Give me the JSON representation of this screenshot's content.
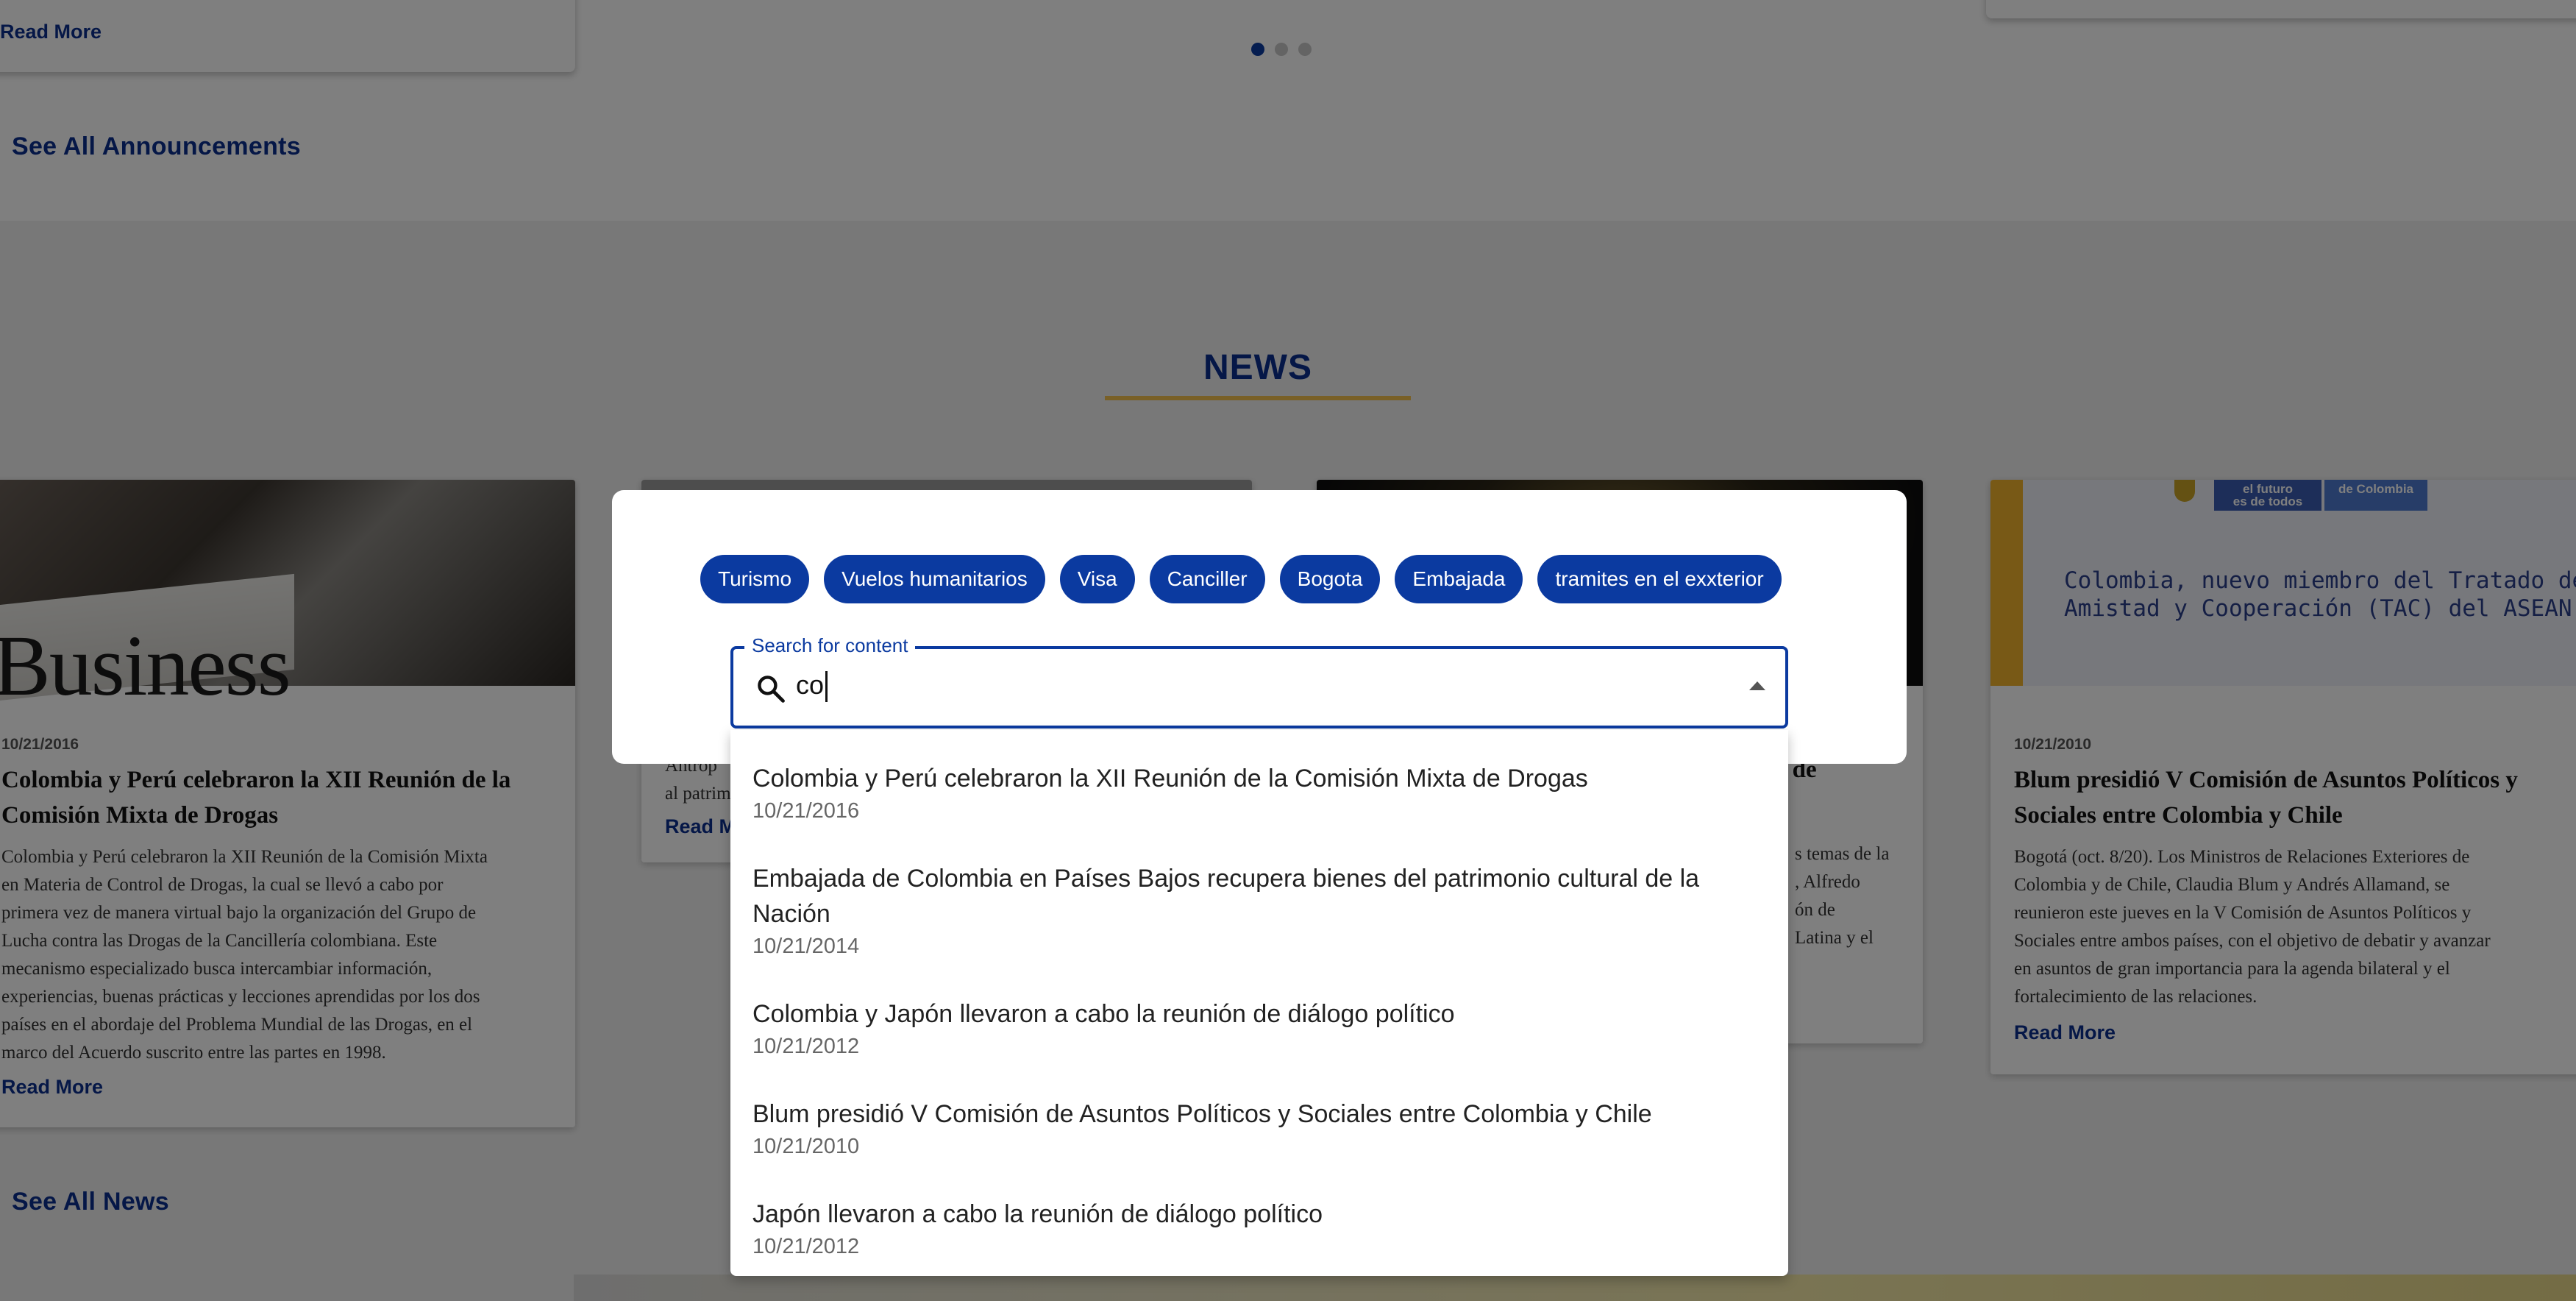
{
  "announcements": {
    "fragment_text": "marco del Acuerdo suscrito entre las partes en 1998.",
    "read_more": "Read More",
    "see_all": "See All Announcements",
    "carousel_dots": 3
  },
  "news": {
    "heading": "NEWS",
    "cards": [
      {
        "image_text": "Business",
        "date": "10/21/2016",
        "title_lines": [
          "Colombia y Perú celebraron la XII Reunión de la",
          "Comisión Mixta de Drogas"
        ],
        "body_lines": [
          "Colombia y Perú celebraron la XII Reunión de la Comisión Mixta",
          "en Materia de Control de Drogas, la cual se llevó a cabo por",
          "primera vez de manera virtual bajo la organización del Grupo de",
          "Lucha contra las Drogas de la Cancillería colombiana. Este",
          "mecanismo especializado busca intercambiar información,",
          "experiencias, buenas prácticas y lecciones aprendidas por los dos",
          "países en el abordaje del Problema Mundial de las Drogas, en el",
          "marco del Acuerdo suscrito entre las partes en 1998."
        ],
        "read_more": "Read More"
      },
      {
        "partial_body_lines": [
          "Antrop",
          "al patrim"
        ],
        "read_more": "Read M"
      },
      {
        "partial_title": "n de",
        "partial_body_lines": [
          "s temas de la",
          ", Alfredo",
          "ón de",
          "Latina y el"
        ]
      },
      {
        "image_pill_left": "el futuro\nes de todos",
        "image_pill_right": "de Colombia",
        "image_text_lines": [
          "Colombia, nuevo miembro del Tratado de",
          "Amistad y Cooperación (TAC) del ASEAN"
        ],
        "date": "10/21/2010",
        "title_lines": [
          "Blum presidió V Comisión de Asuntos Políticos y",
          "Sociales entre Colombia y Chile"
        ],
        "body_lines": [
          "Bogotá (oct. 8/20). Los Ministros de Relaciones Exteriores de",
          "Colombia y de Chile, Claudia Blum y Andrés Allamand, se",
          "reunieron este jueves en la V Comisión de Asuntos Políticos y",
          "Sociales entre ambos países, con el objetivo de debatir y avanzar",
          "en asuntos de gran importancia para la agenda bilateral y el",
          "fortalecimiento de las relaciones."
        ],
        "read_more": "Read More"
      }
    ],
    "see_all": "See All News"
  },
  "search_modal": {
    "chips": [
      "Turismo",
      "Vuelos humanitarios",
      "Visa",
      "Canciller",
      "Bogota",
      "Embajada",
      "tramites en el exxterior"
    ],
    "field_label": "Search for content",
    "field_value": "co",
    "results": [
      {
        "title": "Colombia y Perú celebraron la XII Reunión de la Comisión Mixta de Drogas",
        "date": "10/21/2016"
      },
      {
        "title": "Embajada de Colombia en Países Bajos recupera bienes del patrimonio cultural de la Nación",
        "date": "10/21/2014"
      },
      {
        "title": "Colombia y Japón llevaron a cabo la reunión de diálogo político",
        "date": "10/21/2012"
      },
      {
        "title": "Blum presidió V Comisión de Asuntos Políticos y Sociales entre Colombia y Chile",
        "date": "10/21/2010"
      },
      {
        "title": "Japón llevaron a cabo la reunión de diálogo político",
        "date": "10/21/2012"
      }
    ]
  },
  "colors": {
    "brand_blue": "#0b3aa0",
    "link_blue": "#0b2f8f",
    "accent_gold": "#f2c14e",
    "overlay": "rgba(0,0,0,0.5)"
  }
}
